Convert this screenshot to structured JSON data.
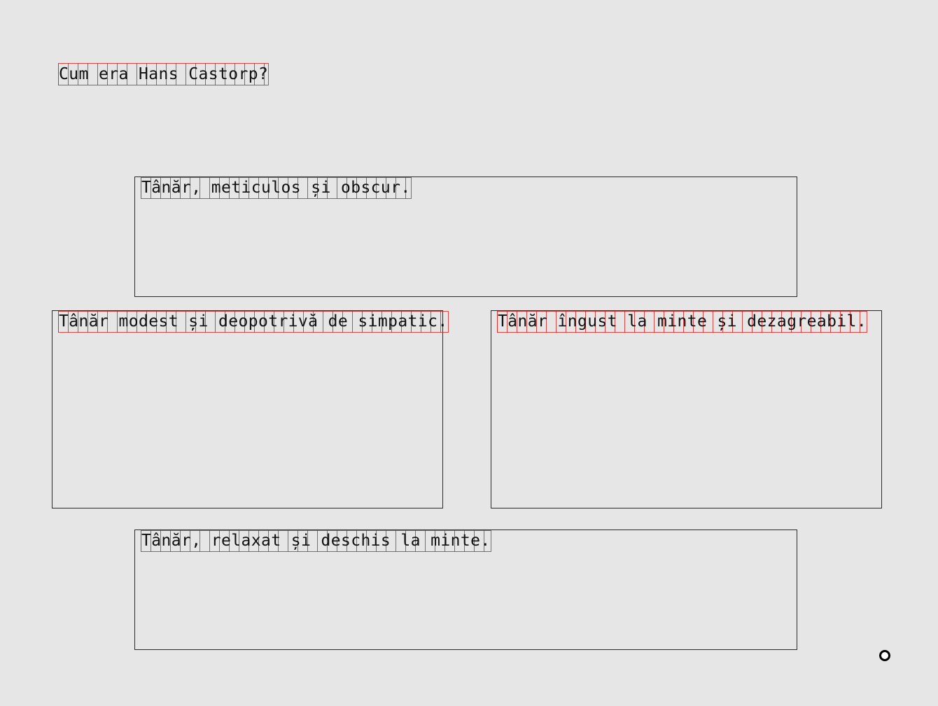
{
  "question": {
    "text": "Cum era Hans Castorp?"
  },
  "answers": [
    {
      "text": "Tânăr, meticulos și obscur."
    },
    {
      "text": "Tânăr modest și deopotrivă de simpatic."
    },
    {
      "text": "Tânăr îngust la minte și dezagreabil."
    },
    {
      "text": "Tânăr, relaxat și deschis la minte."
    }
  ],
  "colors": {
    "background": "#e6e6e6",
    "text": "#111111",
    "box_border": "#2a2a2a",
    "glyph_outline": "#dc2828"
  },
  "icons": {
    "cursor": "ring-cursor-icon"
  }
}
